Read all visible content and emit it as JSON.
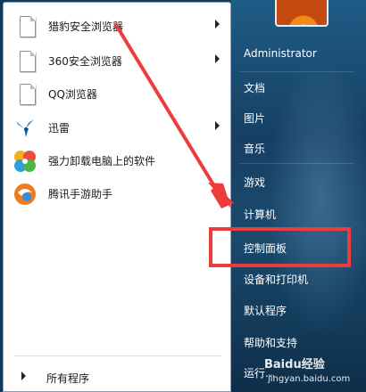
{
  "programs": [
    {
      "label": "猎豹安全浏览器",
      "icon": "document-icon",
      "has_submenu": true
    },
    {
      "label": "360安全浏览器",
      "icon": "document-icon",
      "has_submenu": true
    },
    {
      "label": "QQ浏览器",
      "icon": "document-icon",
      "has_submenu": false
    },
    {
      "label": "迅雷",
      "icon": "thunder-bird-icon",
      "has_submenu": true
    },
    {
      "label": "强力卸载电脑上的软件",
      "icon": "uninstall-clover-icon",
      "has_submenu": false
    },
    {
      "label": "腾讯手游助手",
      "icon": "tencent-game-icon",
      "has_submenu": false
    }
  ],
  "all_programs": "所有程序",
  "right_pane": {
    "items": [
      "Administrator",
      "文档",
      "图片",
      "音乐",
      "游戏",
      "计算机",
      "控制面板",
      "设备和打印机",
      "默认程序",
      "帮助和支持",
      "运行..."
    ],
    "highlighted": "控制面板"
  },
  "annotation": {
    "highlight_color": "#ee3b3b"
  },
  "watermark": {
    "brand": "Baidu经验",
    "url": "jingyan.baidu.com"
  }
}
